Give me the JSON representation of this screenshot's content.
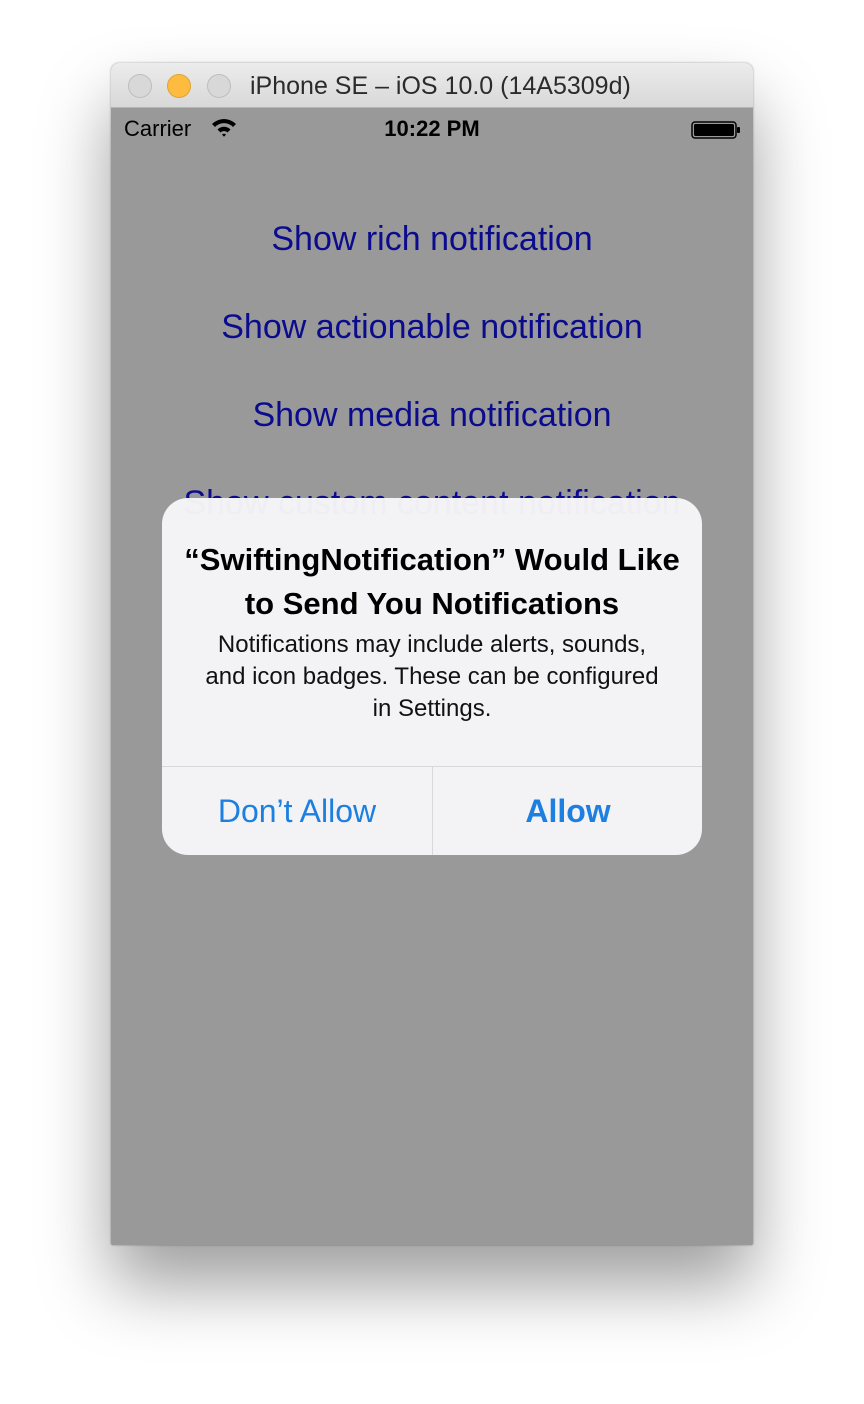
{
  "window": {
    "title": "iPhone SE – iOS 10.0 (14A5309d)"
  },
  "status_bar": {
    "carrier": "Carrier",
    "time": "10:22 PM",
    "wifi_icon": "wifi-icon",
    "battery_icon": "battery-full-icon"
  },
  "app": {
    "buttons": [
      {
        "label": "Show rich notification"
      },
      {
        "label": "Show actionable notification"
      },
      {
        "label": "Show media notification"
      },
      {
        "label": "Show custom content notification"
      }
    ],
    "button_color": "#0b0b8d",
    "background_color": "#999999"
  },
  "alert": {
    "title": "“SwiftingNotification” Would Like to Send You Notifications",
    "message": "Notifications may include alerts, sounds, and icon badges. These can be configured in Settings.",
    "deny_label": "Don’t Allow",
    "allow_label": "Allow",
    "button_color": "#1d7fe0"
  }
}
